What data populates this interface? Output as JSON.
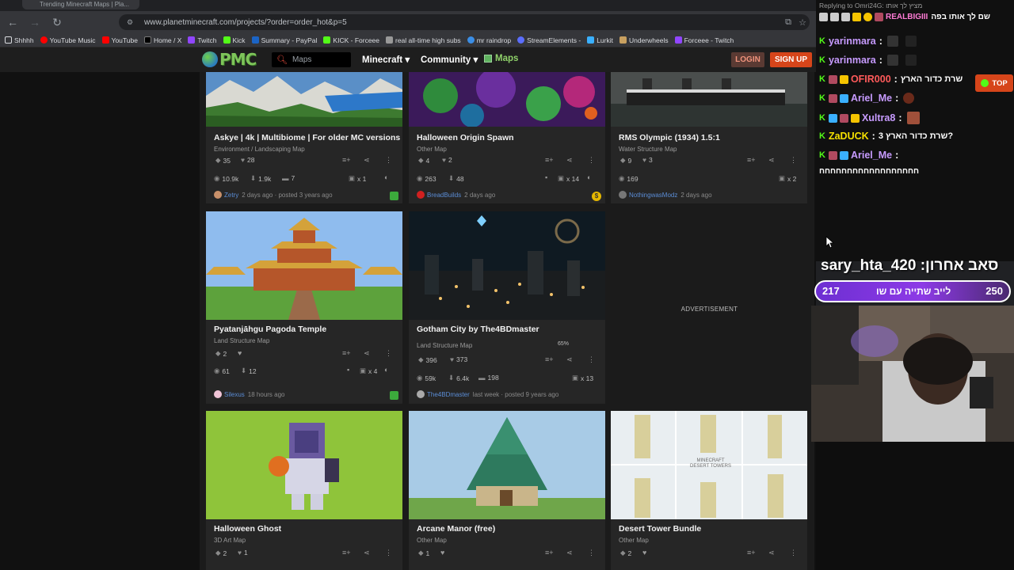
{
  "browser": {
    "tab_title": "Trending Minecraft Maps | Pla...",
    "url": "www.planetminecraft.com/projects/?order=order_hot&p=5",
    "bookmarks": [
      "Shhhh",
      "YouTube Music",
      "YouTube",
      "Home / X",
      "Twitch",
      "Kick",
      "Summary - PayPal",
      "KICK - Forceee",
      "real all-time high subs",
      "mr raindrop",
      "StreamElements -",
      "Lurkit",
      "Underwheels",
      "Forceee - Twitch"
    ]
  },
  "site": {
    "search_placeholder": "Maps",
    "nav": {
      "minecraft": "Minecraft ▾",
      "community": "Community ▾",
      "maps": "Maps"
    },
    "login": "LOGIN",
    "signup": "SIGN UP",
    "advertisement": "ADVERTISEMENT"
  },
  "cards": [
    {
      "title": "Askye | 4k | Multibiome | For older MC versions",
      "category": "Environment / Landscaping Map",
      "diamonds": "35",
      "hearts": "28",
      "views": "10.9k",
      "downloads": "1.9k",
      "comments": "7",
      "x": "x 1",
      "author": "Zetry",
      "time": "2 days ago · posted 3 years ago"
    },
    {
      "title": "Halloween Origin Spawn",
      "category": "Other Map",
      "diamonds": "4",
      "hearts": "2",
      "views": "263",
      "downloads": "48",
      "x": "x 14",
      "author": "BreadBuilds",
      "time": "2 days ago"
    },
    {
      "title": "RMS Olympic (1934) 1.5:1",
      "category": "Water Structure Map",
      "diamonds": "9",
      "hearts": "3",
      "views": "169",
      "x": "x 2",
      "author": "NothingwasModz",
      "time": "2 days ago"
    },
    {
      "title": "Pyatanjāhgu Pagoda Temple",
      "category": "Land Structure Map",
      "diamonds": "2",
      "views": "61",
      "downloads": "12",
      "x": "x 4",
      "author": "Silexus",
      "time": "18 hours ago"
    },
    {
      "title": "Gotham City by The4BDmaster",
      "category": "Land Structure Map",
      "progress": "65%",
      "diamonds": "396",
      "hearts": "373",
      "views": "59k",
      "downloads": "6.4k",
      "comments": "198",
      "x": "x 13",
      "author": "The4BDmaster",
      "time": "last week · posted 9 years ago"
    },
    {
      "title": "Halloween Ghost",
      "category": "3D Art Map",
      "diamonds": "2",
      "hearts": "1"
    },
    {
      "title": "Arcane Manor (free)",
      "category": "Other Map",
      "diamonds": "1"
    },
    {
      "title": "Desert Tower Bundle",
      "category": "Other Map",
      "diamonds": "2",
      "thumb_label": "MINECRAFT DESERT TOWERS"
    }
  ],
  "chat": {
    "reply_line": "Replying to Omri24G: מציץ לך אותו",
    "pinned_msg": "שם לך אותו בפה",
    "pinned_user": "REALBIGIII",
    "messages": [
      {
        "user": "yarinmara",
        "text": "",
        "color": "#c79bff"
      },
      {
        "user": "yarinmara",
        "text": "",
        "color": "#c79bff"
      },
      {
        "user": "OFIR000",
        "text": "שרת כדור הארץ",
        "color": "#ff5a5a"
      },
      {
        "user": "Ariel_Me",
        "text": "",
        "color": "#c79bff"
      },
      {
        "user": "Xultra8",
        "text": "",
        "color": "#c79bff"
      },
      {
        "user": "ZaDUCK",
        "text": "3 שרת כדור הארץ?",
        "color": "#f5e000"
      },
      {
        "user": "Ariel_Me",
        "text": "",
        "color": "#c79bff"
      }
    ],
    "continuation": "חחחחחחחחחחחחחחחחחח",
    "top_button": "TOP"
  },
  "poll": {
    "title": "sary_hta_420 :סאב אחרון",
    "left_value": "217",
    "label": "לייב שתייה עם שו",
    "right_value": "250"
  },
  "colors": {
    "accent": "#d6451a",
    "kick_green": "#53fc18",
    "poll_purple": "#8d3ae6",
    "site_green": "#7ec55a"
  }
}
